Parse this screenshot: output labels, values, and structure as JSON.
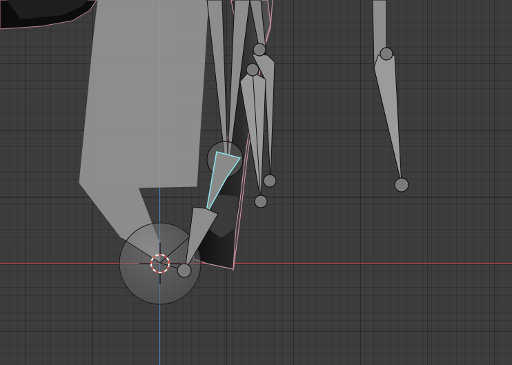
{
  "viewport": {
    "background": "#3d3d3d",
    "axis_x_color": "#c1434f",
    "axis_y_color": "#4a7eb8",
    "mesh_fill": "#9a9a9a",
    "mesh_outline": "#c58fa0",
    "bone_fill": "#8d8d8d",
    "bone_selected_outline": "#8fe1ea",
    "cursor_colors": [
      "#e84f4f",
      "#ffffff"
    ]
  }
}
